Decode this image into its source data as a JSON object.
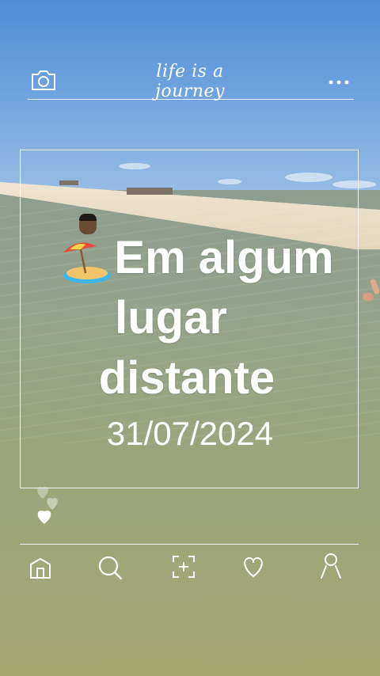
{
  "header": {
    "title": "life is a journey",
    "camera_icon": "camera-icon",
    "more_icon": "more-dots-icon"
  },
  "card": {
    "emoji": "beach-umbrella-emoji",
    "headline_line1": "Em algum",
    "headline_line2": "lugar",
    "headline_line3": "distante",
    "date": "31/07/2024"
  },
  "reactions": {
    "icon": "hearts-icon"
  },
  "bottom_nav": {
    "items": [
      {
        "name": "home-icon"
      },
      {
        "name": "search-icon"
      },
      {
        "name": "add-post-icon"
      },
      {
        "name": "heart-icon"
      },
      {
        "name": "profile-icon"
      }
    ]
  },
  "colors": {
    "overlay": "#ffffff",
    "sky": "#5b95da",
    "water": "#9aa57c"
  }
}
